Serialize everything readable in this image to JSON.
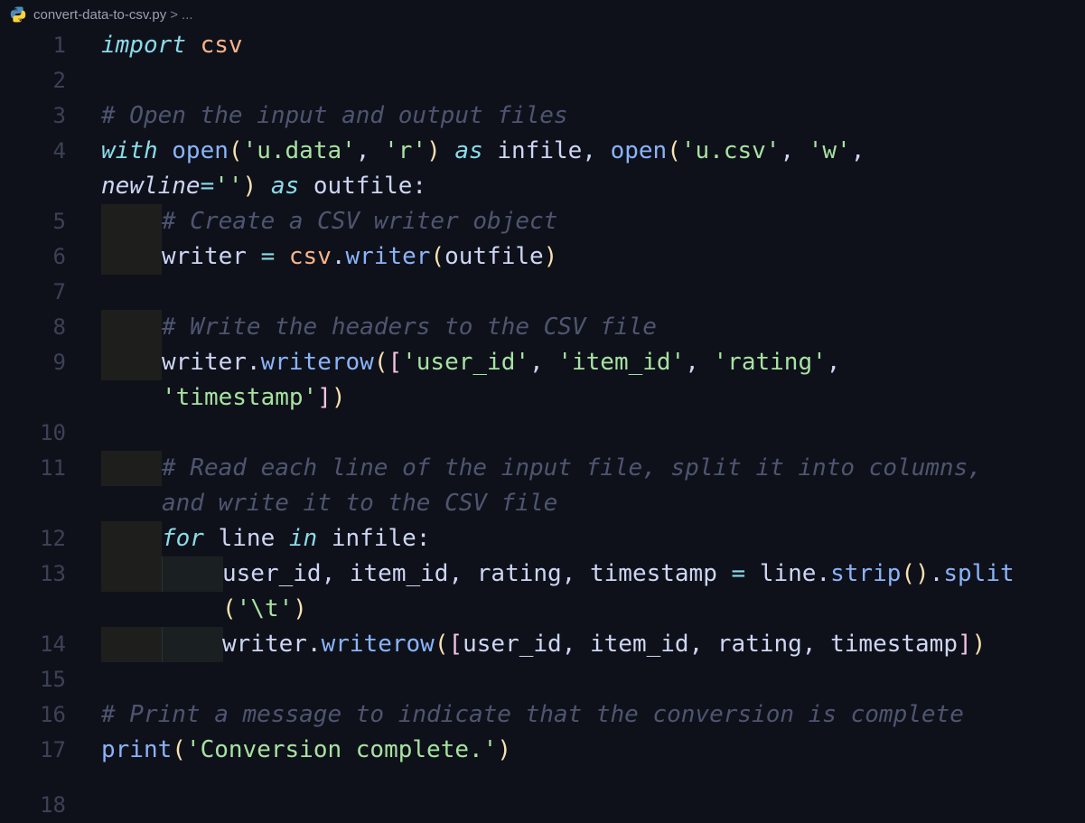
{
  "breadcrumb": {
    "file_name": "convert-data-to-csv.py",
    "separator": ">",
    "ellipsis": "..."
  },
  "editor": {
    "lines": [
      {
        "number": "1",
        "text": "import csv"
      },
      {
        "number": "2",
        "text": ""
      },
      {
        "number": "3",
        "text": "# Open the input and output files"
      },
      {
        "number": "4",
        "text": "with open('u.data', 'r') as infile, open('u.csv', 'w',"
      },
      {
        "number": "",
        "text": "newline='') as outfile:"
      },
      {
        "number": "5",
        "text": "# Create a CSV writer object"
      },
      {
        "number": "6",
        "text": "writer = csv.writer(outfile)"
      },
      {
        "number": "7",
        "text": ""
      },
      {
        "number": "8",
        "text": "# Write the headers to the CSV file"
      },
      {
        "number": "9",
        "text": "writer.writerow(['user_id', 'item_id', 'rating',"
      },
      {
        "number": "",
        "text": "'timestamp'])"
      },
      {
        "number": "10",
        "text": ""
      },
      {
        "number": "11",
        "text": "# Read each line of the input file, split it into columns,"
      },
      {
        "number": "",
        "text": "and write it to the CSV file"
      },
      {
        "number": "12",
        "text": "for line in infile:"
      },
      {
        "number": "13",
        "text": "user_id, item_id, rating, timestamp = line.strip().split"
      },
      {
        "number": "",
        "text": "('\\t')"
      },
      {
        "number": "14",
        "text": "writer.writerow([user_id, item_id, rating, timestamp])"
      },
      {
        "number": "15",
        "text": ""
      },
      {
        "number": "16",
        "text": "# Print a message to indicate that the conversion is complete"
      },
      {
        "number": "17",
        "text": "print('Conversion complete.')"
      },
      {
        "number": "18",
        "text": ""
      }
    ]
  },
  "colors": {
    "background": "#0f111a",
    "keyword": "#89dceb",
    "module": "#fab387",
    "comment": "#4e5570",
    "function": "#89b4fa",
    "string": "#a6e3a1",
    "bracket_level1": "#f9e2af",
    "bracket_level2": "#f5c2e7",
    "line_number": "#3c4155"
  }
}
